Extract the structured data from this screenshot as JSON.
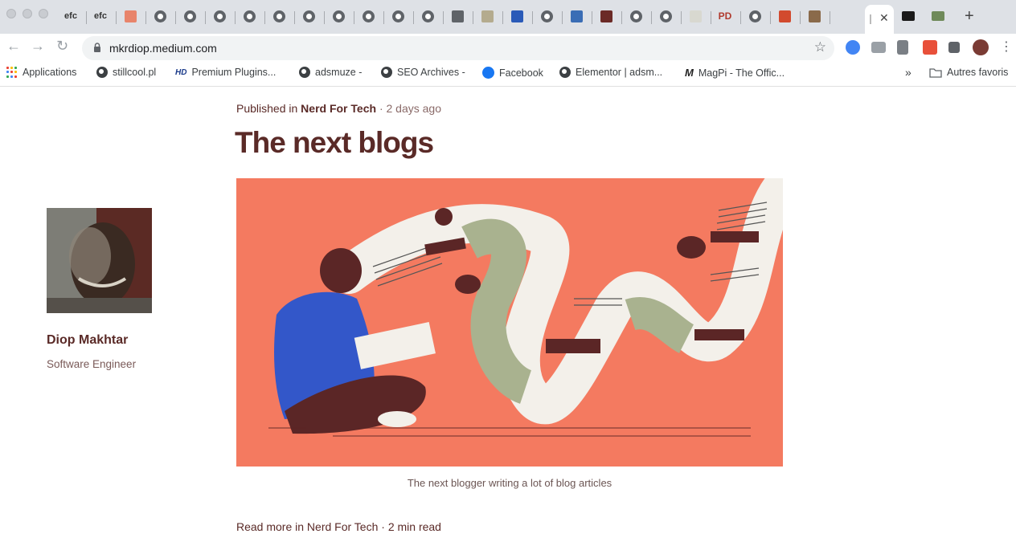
{
  "browser": {
    "tabs": [
      {
        "label": "efc",
        "icon": "efc-text-icon"
      },
      {
        "label": "efc",
        "icon": "efc-text-icon"
      },
      {
        "label": "",
        "icon": "stylized-s-icon"
      },
      {
        "label": "",
        "icon": "globe-icon"
      },
      {
        "label": "",
        "icon": "globe-icon"
      },
      {
        "label": "",
        "icon": "globe-icon"
      },
      {
        "label": "",
        "icon": "globe-icon"
      },
      {
        "label": "",
        "icon": "globe-icon"
      },
      {
        "label": "",
        "icon": "globe-icon"
      },
      {
        "label": "",
        "icon": "globe-icon"
      },
      {
        "label": "",
        "icon": "globe-icon"
      },
      {
        "label": "",
        "icon": "globe-icon"
      },
      {
        "label": "",
        "icon": "globe-icon"
      },
      {
        "label": "",
        "icon": "building-icon"
      },
      {
        "label": "",
        "icon": "t-logo-icon"
      },
      {
        "label": "",
        "icon": "em-logo-icon"
      },
      {
        "label": "",
        "icon": "globe-icon"
      },
      {
        "label": "",
        "icon": "arrows-logo-icon"
      },
      {
        "label": "",
        "icon": "dark-logo-icon"
      },
      {
        "label": "",
        "icon": "globe-icon"
      },
      {
        "label": "",
        "icon": "globe-icon"
      },
      {
        "label": "",
        "icon": "bird-icon"
      },
      {
        "label": "PD",
        "icon": "pd-logo-icon"
      },
      {
        "label": "",
        "icon": "globe-icon"
      },
      {
        "label": "",
        "icon": "red-figure-icon"
      },
      {
        "label": "",
        "icon": "trident-icon"
      }
    ],
    "active_tab": {
      "label": "",
      "close": "✕"
    },
    "after_tabs": [
      {
        "label": "",
        "icon": "medium-logo-icon"
      },
      {
        "label": "",
        "icon": "tree-icon"
      }
    ],
    "new_tab": "+",
    "url": "mkrdiop.medium.com",
    "bookmarks": [
      {
        "label": "Applications",
        "icon": "apps-grid-icon"
      },
      {
        "label": "stillcool.pl",
        "icon": "globe-icon"
      },
      {
        "label": "Premium Plugins...",
        "icon": "hd-icon"
      },
      {
        "label": "adsmuze -",
        "icon": "globe-icon"
      },
      {
        "label": "SEO Archives -",
        "icon": "globe-icon"
      },
      {
        "label": "Facebook",
        "icon": "facebook-icon"
      },
      {
        "label": "Elementor | adsm...",
        "icon": "globe-icon"
      },
      {
        "label": "MagPi - The Offic...",
        "icon": "magpi-icon"
      }
    ],
    "bookmarks_overflow": "»",
    "other_bookmarks": "Autres favoris"
  },
  "page": {
    "published_prefix": "Published in",
    "publication": "Nerd For Tech",
    "published_time": "· 2 days ago",
    "title": "The next blogs",
    "hero_caption": "The next blogger writing a lot of blog articles",
    "read_more": "Read more in Nerd For Tech · 2 min read"
  },
  "author": {
    "name": "Diop Makhtar",
    "role": "Software Engineer"
  },
  "colors": {
    "title": "#5a2a27",
    "hero_bg": "#f47a60",
    "tabstrip_bg": "#dee1e6"
  }
}
